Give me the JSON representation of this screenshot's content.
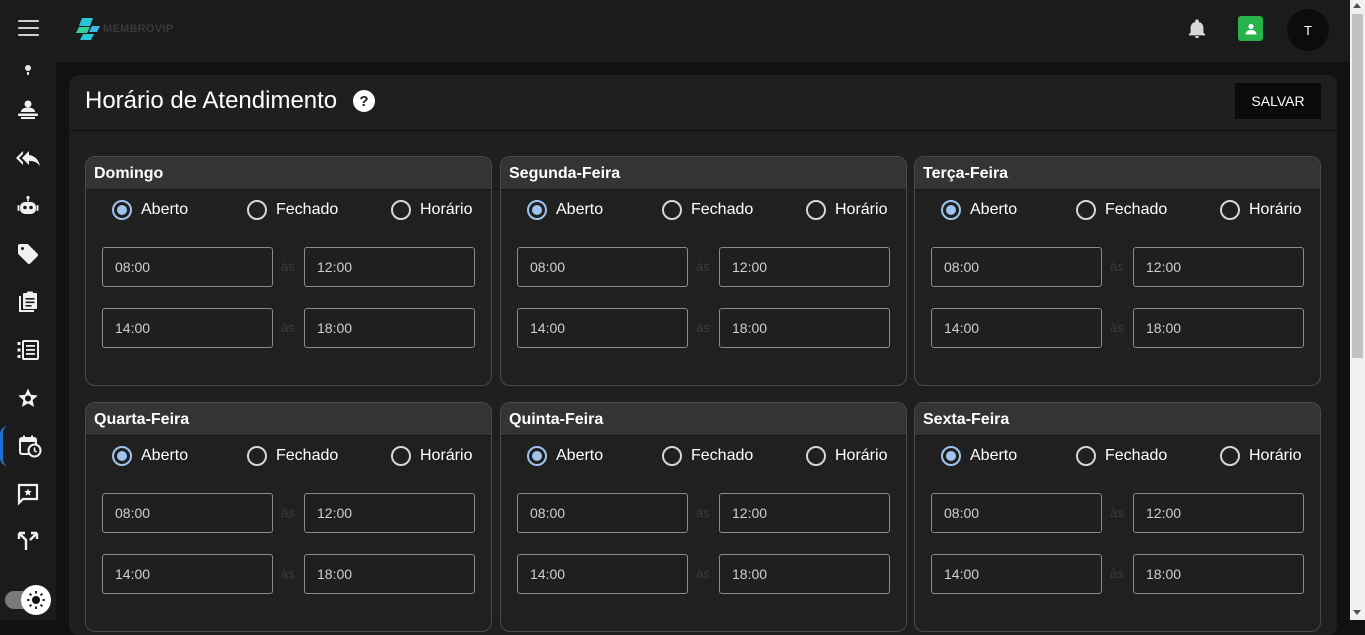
{
  "app": {
    "brand": "MEMBROVIP",
    "user_initial": "T"
  },
  "page": {
    "title": "Horário de Atendimento",
    "help": "?",
    "save_label": "SALVAR"
  },
  "radio_labels": {
    "open": "Aberto",
    "closed": "Fechado",
    "schedule": "Horário"
  },
  "separator": "às",
  "days": [
    {
      "name": "Domingo",
      "selected": "Aberto",
      "morning_start": "08:00",
      "morning_end": "12:00",
      "afternoon_start": "14:00",
      "afternoon_end": "18:00"
    },
    {
      "name": "Segunda-Feira",
      "selected": "Aberto",
      "morning_start": "08:00",
      "morning_end": "12:00",
      "afternoon_start": "14:00",
      "afternoon_end": "18:00"
    },
    {
      "name": "Terça-Feira",
      "selected": "Aberto",
      "morning_start": "08:00",
      "morning_end": "12:00",
      "afternoon_start": "14:00",
      "afternoon_end": "18:00"
    },
    {
      "name": "Quarta-Feira",
      "selected": "Aberto",
      "morning_start": "08:00",
      "morning_end": "12:00",
      "afternoon_start": "14:00",
      "afternoon_end": "18:00"
    },
    {
      "name": "Quinta-Feira",
      "selected": "Aberto",
      "morning_start": "08:00",
      "morning_end": "12:00",
      "afternoon_start": "14:00",
      "afternoon_end": "18:00"
    },
    {
      "name": "Sexta-Feira",
      "selected": "Aberto",
      "morning_start": "08:00",
      "morning_end": "12:00",
      "afternoon_start": "14:00",
      "afternoon_end": "18:00"
    }
  ],
  "sidebar_icons": [
    "bulb-icon",
    "person-desk-icon",
    "reply-all-icon",
    "robot-icon",
    "tag-icon",
    "clipboard-icon",
    "list-icon",
    "star-icon",
    "calendar-clock-icon",
    "chat-icon",
    "merge-icon"
  ],
  "colors": {
    "accent": "#9ec3ec",
    "active_bar": "#1f6fd1",
    "contact_green": "#27b24a",
    "logo_cyan": "#28c5d8"
  }
}
